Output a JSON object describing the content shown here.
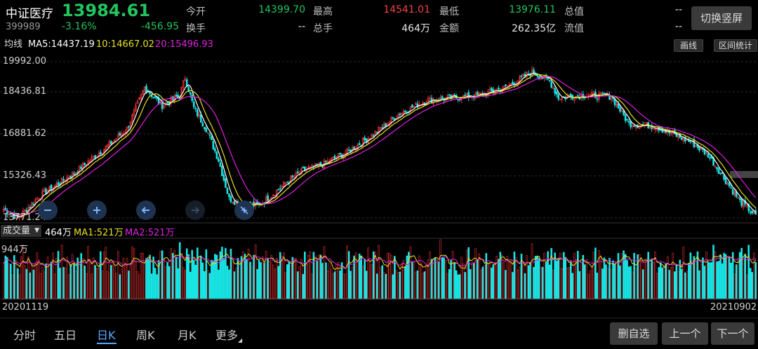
{
  "header": {
    "name": "中证医疗",
    "price": "13984.61",
    "code": "399989",
    "pct": "-3.16%",
    "change": "-456.95",
    "stats": [
      {
        "label": "今开",
        "value": "14399.70",
        "color": "green"
      },
      {
        "label": "最高",
        "value": "14541.01",
        "color": "red"
      },
      {
        "label": "最低",
        "value": "13976.11",
        "color": "green"
      },
      {
        "label": "总值",
        "value": "--",
        "color": "white"
      },
      {
        "label": "换手",
        "value": "--",
        "color": "white"
      },
      {
        "label": "总手",
        "value": "464万",
        "color": "white"
      },
      {
        "label": "金额",
        "value": "262.35亿",
        "color": "white"
      },
      {
        "label": "流值",
        "value": "--",
        "color": "white"
      }
    ],
    "toggle_label": "切换竖屏"
  },
  "toolbar": {
    "avg_label": "均线",
    "ma5": "MA5:14437.19",
    "ma10": "10:14667.02",
    "ma20": "20:15496.93",
    "draw_label": "画线",
    "range_label": "区间统计"
  },
  "volume_bar": {
    "selector": "成交量",
    "value": "464万",
    "ma1": "MA1:521万",
    "ma2": "MA2:521万",
    "max_label": "944万"
  },
  "dates": {
    "start": "20201119",
    "end": "20210902"
  },
  "nav": {
    "tabs": [
      "分时",
      "五日",
      "日K",
      "周K",
      "月K",
      "更多"
    ],
    "active": 2,
    "buttons": [
      "删自选",
      "上一个",
      "下一个"
    ]
  },
  "colors": {
    "up": "#e03030",
    "down": "#19e5e5",
    "ma5": "#ffffff",
    "ma10": "#e8e020",
    "ma20": "#e020e0",
    "volma1": "#e8e020",
    "volma2": "#e020e0"
  },
  "chart_data": {
    "type": "candlestick",
    "y_ticks": [
      "19992.00",
      "18436.81",
      "16881.62",
      "15326.43",
      "13771.24"
    ],
    "ylim": [
      13771.24,
      19992.0
    ],
    "vol_max": 944,
    "anchors": [
      [
        0,
        14300
      ],
      [
        8,
        13950
      ],
      [
        20,
        14800
      ],
      [
        40,
        15700
      ],
      [
        60,
        16800
      ],
      [
        70,
        17400
      ],
      [
        80,
        19000
      ],
      [
        90,
        18300
      ],
      [
        100,
        18700
      ],
      [
        103,
        19400
      ],
      [
        108,
        18200
      ],
      [
        115,
        17400
      ],
      [
        122,
        16200
      ],
      [
        128,
        14700
      ],
      [
        135,
        14500
      ],
      [
        145,
        14450
      ],
      [
        160,
        15300
      ],
      [
        170,
        15800
      ],
      [
        180,
        16000
      ],
      [
        195,
        16500
      ],
      [
        210,
        17200
      ],
      [
        225,
        18000
      ],
      [
        240,
        18500
      ],
      [
        255,
        18600
      ],
      [
        270,
        18700
      ],
      [
        285,
        19000
      ],
      [
        300,
        19600
      ],
      [
        310,
        19250
      ],
      [
        315,
        18600
      ],
      [
        330,
        18700
      ],
      [
        345,
        18650
      ],
      [
        355,
        17600
      ],
      [
        370,
        17500
      ],
      [
        378,
        17250
      ],
      [
        390,
        16900
      ],
      [
        400,
        16400
      ],
      [
        410,
        15400
      ],
      [
        418,
        14600
      ],
      [
        427,
        14050
      ]
    ],
    "n": 428
  }
}
